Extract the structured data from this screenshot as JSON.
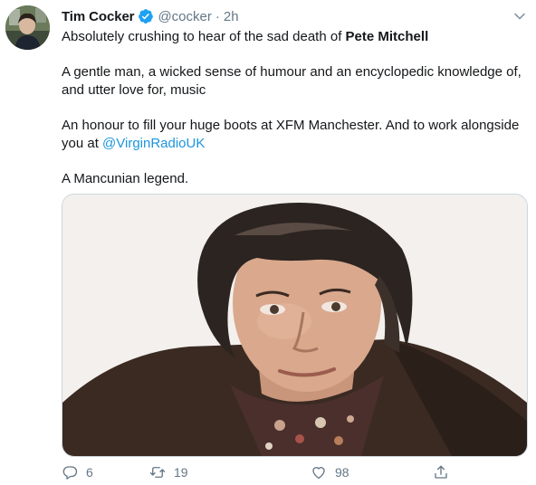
{
  "tweet": {
    "author": {
      "display_name": "Tim Cocker",
      "handle": "@cocker",
      "verified": true,
      "avatar_icon": "profile-photo"
    },
    "separator": "·",
    "timestamp": "2h",
    "text": {
      "p1_prefix": "Absolutely crushing to hear of the sad death of ",
      "p1_bold": "Pete Mitchell",
      "p2": "A gentle man, a wicked sense of humour and an encyclopedic knowledge of, and utter love for, music",
      "p3_prefix": "An honour to fill your huge boots at XFM Manchester. And to work alongside you at ",
      "p3_mention": "@VirginRadioUK",
      "p4": "A Mancunian legend."
    },
    "media": {
      "type": "photo"
    },
    "actions": {
      "reply_icon": "reply-icon",
      "reply_count": "6",
      "retweet_icon": "retweet-icon",
      "retweet_count": "19",
      "like_icon": "like-icon",
      "like_count": "98",
      "share_icon": "share-icon"
    }
  },
  "colors": {
    "text": "#14171a",
    "secondary": "#657786",
    "link": "#1b95e0",
    "verified": "#1da1f2",
    "border": "#ccd6dd"
  }
}
